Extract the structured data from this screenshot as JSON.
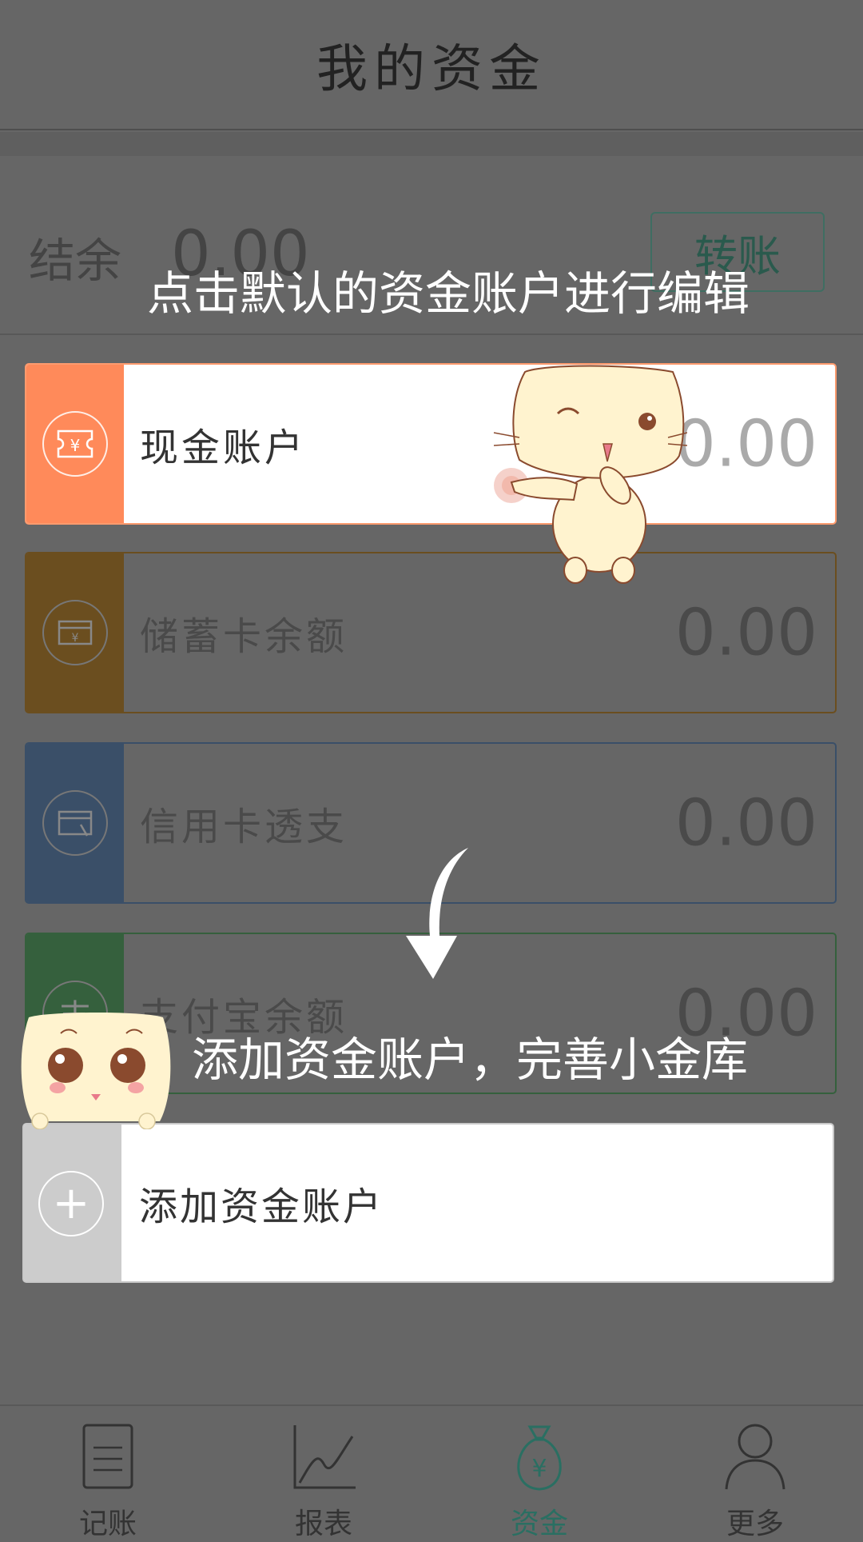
{
  "header": {
    "title": "我的资金"
  },
  "balance": {
    "label": "结余",
    "value": "0.00",
    "transfer_label": "转账"
  },
  "accounts": [
    {
      "name": "现金账户",
      "amount": "0.00",
      "color": "#ff8a5a",
      "icon": "cash-icon",
      "highlighted": true
    },
    {
      "name": "储蓄卡余额",
      "amount": "0.00",
      "color": "#6b4e1f",
      "icon": "bank-card-icon",
      "highlighted": false
    },
    {
      "name": "信用卡透支",
      "amount": "0.00",
      "color": "#3a4f68",
      "icon": "credit-card-icon",
      "highlighted": false
    },
    {
      "name": "支付宝余额",
      "amount": "0.00",
      "color": "#35603d",
      "icon": "alipay-icon",
      "highlighted": false
    }
  ],
  "add_account": {
    "label": "添加资金账户",
    "icon": "plus-icon"
  },
  "guide": {
    "tip_edit": "点击默认的资金账户进行编辑",
    "tip_add": "添加资金账户，完善小金库"
  },
  "tabs": [
    {
      "label": "记账",
      "icon": "notebook-icon",
      "active": false
    },
    {
      "label": "报表",
      "icon": "chart-icon",
      "active": false
    },
    {
      "label": "资金",
      "icon": "money-bag-icon",
      "active": true
    },
    {
      "label": "更多",
      "icon": "user-icon",
      "active": false
    }
  ],
  "colors": {
    "overlay": "#666666",
    "accent": "#2a6f62",
    "cash": "#ff8a5a"
  }
}
